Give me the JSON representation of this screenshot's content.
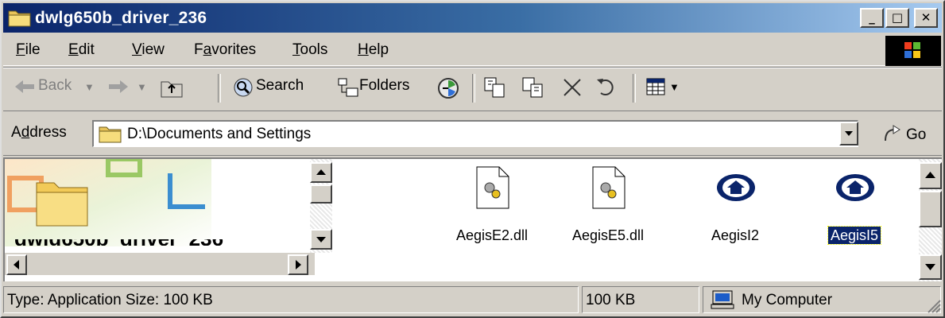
{
  "window": {
    "title": "dwlg650b_driver_236",
    "buttons": {
      "minimize": "_",
      "maximize": "□",
      "close": "✕"
    }
  },
  "menu": {
    "items": [
      {
        "pre": "",
        "u": "F",
        "post": "ile"
      },
      {
        "pre": "",
        "u": "E",
        "post": "dit"
      },
      {
        "pre": "",
        "u": "V",
        "post": "iew"
      },
      {
        "pre": "F",
        "u": "a",
        "post": "vorites"
      },
      {
        "pre": "",
        "u": "T",
        "post": "ools"
      },
      {
        "pre": "",
        "u": "H",
        "post": "elp"
      }
    ]
  },
  "toolbar": {
    "back_label": "Back",
    "search_label": "Search",
    "folders_label": "Folders"
  },
  "address": {
    "label_pre": "A",
    "label_u": "d",
    "label_post": "dress",
    "value": "D:\\Documents and Settings",
    "go_label": "Go"
  },
  "files": [
    {
      "name": "AegisE2.dll",
      "icon": "dll-file-icon",
      "selected": false
    },
    {
      "name": "AegisE5.dll",
      "icon": "dll-file-icon",
      "selected": false
    },
    {
      "name": "AegisI2",
      "icon": "aegis-app-icon",
      "selected": false
    },
    {
      "name": "AegisI5",
      "icon": "aegis-app-icon",
      "selected": true
    }
  ],
  "leftpane": {
    "partial_text": "dwlg650b_driver_236"
  },
  "status": {
    "info": "Type: Application Size: 100 KB",
    "size": "100 KB",
    "zone": "My Computer"
  },
  "colors": {
    "title_start": "#0a246a",
    "title_end": "#a6caf0",
    "chrome": "#d4d0c8",
    "selection": "#0a246a"
  }
}
